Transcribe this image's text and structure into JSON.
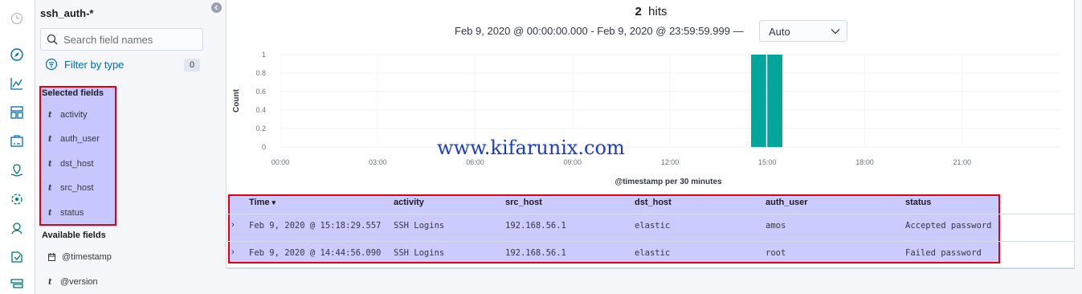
{
  "nav": {
    "icons": [
      "clock-icon",
      "compass-icon",
      "visualize-icon",
      "dashboard-icon",
      "canvas-icon",
      "maps-icon",
      "ml-icon",
      "uptime-icon",
      "siem-icon",
      "stack-icon"
    ]
  },
  "sidebar": {
    "index_pattern": "ssh_auth-*",
    "search_placeholder": "Search field names",
    "filter_label": "Filter by type",
    "filter_count": "0",
    "selected_title": "Selected fields",
    "selected_fields": [
      {
        "type": "t",
        "name": "activity"
      },
      {
        "type": "t",
        "name": "auth_user"
      },
      {
        "type": "t",
        "name": "dst_host"
      },
      {
        "type": "t",
        "name": "src_host"
      },
      {
        "type": "t",
        "name": "status"
      }
    ],
    "available_title": "Available fields",
    "available_fields": [
      {
        "type": "date",
        "name": "@timestamp"
      },
      {
        "type": "t",
        "name": "@version"
      }
    ]
  },
  "header": {
    "hits_count": "2",
    "hits_label": "hits",
    "time_range": "Feb 9, 2020 @ 00:00:00.000 - Feb 9, 2020 @ 23:59:59.999 —",
    "interval": "Auto"
  },
  "watermark": "www.kifarunix.com",
  "chart_data": {
    "type": "bar",
    "title": "",
    "xlabel": "@timestamp per 30 minutes",
    "ylabel": "Count",
    "ylim": [
      0,
      1
    ],
    "yticks": [
      "0",
      "0.2",
      "0.4",
      "0.6",
      "0.8",
      "1"
    ],
    "xticks": [
      "00:00",
      "03:00",
      "06:00",
      "09:00",
      "12:00",
      "15:00",
      "18:00",
      "21:00"
    ],
    "x_domain_hours": [
      0,
      24
    ],
    "bar_width_hours": 0.5,
    "bar_color": "#00a69b",
    "bars": [
      {
        "start_hour": 14.5,
        "value": 1
      },
      {
        "start_hour": 15.0,
        "value": 1
      }
    ],
    "grid": true,
    "legend": "none"
  },
  "table": {
    "sort_indicator": "▾",
    "columns": [
      "Time",
      "activity",
      "src_host",
      "dst_host",
      "auth_user",
      "status"
    ],
    "rows": [
      [
        "Feb 9, 2020 @ 15:18:29.557",
        "SSH Logins",
        "192.168.56.1",
        "elastic",
        "amos",
        "Accepted password"
      ],
      [
        "Feb 9, 2020 @ 14:44:56.090",
        "SSH Logins",
        "192.168.56.1",
        "elastic",
        "root",
        "Failed password"
      ]
    ]
  }
}
